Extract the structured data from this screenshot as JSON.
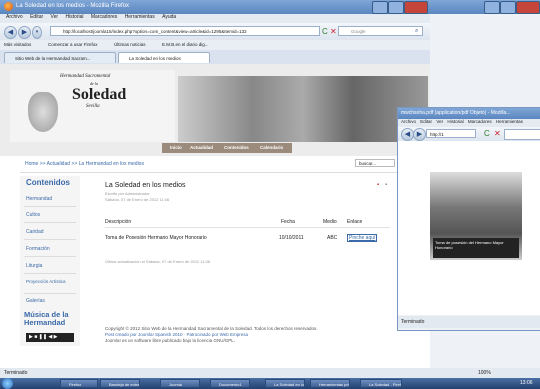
{
  "window": {
    "title": "La Soledad en los medios - Mozilla Firefox",
    "menu": [
      "Archivo",
      "Editar",
      "Ver",
      "Historial",
      "Marcadores",
      "Herramientas",
      "Ayuda"
    ],
    "url": "http://localhost/joomla15/index.php?option=com_content&view=article&id=1295&Itemid=132",
    "search_placeholder": "Google",
    "bookmarks": [
      "Más visitados",
      "Comenzar a usar Firefox",
      "Últimas noticias",
      "E.M.B.en el diario dig..."
    ],
    "tabs": [
      "Sitio Web de la Hermandad Sacram...",
      "La Soledad en los medios"
    ],
    "status": "Terminado"
  },
  "page": {
    "logo_title": "Soledad",
    "logo_sub1": "Hermandad Sacramental",
    "logo_sub2": "de la",
    "logo_sub3": "Sevilla",
    "nav": [
      "Inicio",
      "Actualidad",
      "Contenidos",
      "Calendario"
    ],
    "breadcrumb": "Home >> Actualidad >> La Hermandad en los medios",
    "search": "buscar...",
    "sidebar_title": "Contenidos",
    "sidebar_items": [
      "Hermandad",
      "Cultos",
      "Caridad",
      "Formación",
      "Liturgia",
      "Proyección Artística",
      "Galerías"
    ],
    "musica": "Música de la Hermandad",
    "article_title": "La Soledad en los medios",
    "article_meta1": "Escrito por Administrador",
    "article_meta2": "Sábado, 07 de Enero de 2012 11:06",
    "table_headers": [
      "Descripción",
      "Fecha",
      "Medio",
      "Enlace"
    ],
    "table_row": [
      "Toma de Posesión Hermano Mayor Honorario",
      "10/10/2011",
      "ABC",
      "Pinche aquí"
    ],
    "last_updated": "Última actualización el Sábado, 07 de Enero de 2012 11:06",
    "footer1": "Copyright © 2012 Sitio Web de la Hermandad Sacramental de la Soledad. Todos los derechos reservados.",
    "footer2": "Post creado por Joomla! Spanish 2010 · Patrocinado por Web Empresa",
    "footer3": "Joomla! es un software libre publicado bajo la licencia GNU/GPL."
  },
  "popup": {
    "title": "mwchsoha.pdf (application/pdf Objeto) - Mozilla...",
    "menu": [
      "Archivo",
      "Editar",
      "Ver",
      "Historial",
      "Marcadores",
      "Herramientas"
    ],
    "url": "http://1",
    "caption": "Toma de posesión del Hermano Mayor Honorario",
    "status": "Terminado"
  },
  "statusbar": {
    "zoom": "100%"
  },
  "taskbar": {
    "items": [
      "Firefox",
      "Bandeja de entrada",
      "Joomla",
      "Documento1",
      "La Soledad en los...",
      "Herramientas pdf",
      "La Soledad - Firefox"
    ],
    "clock": "13:06"
  }
}
